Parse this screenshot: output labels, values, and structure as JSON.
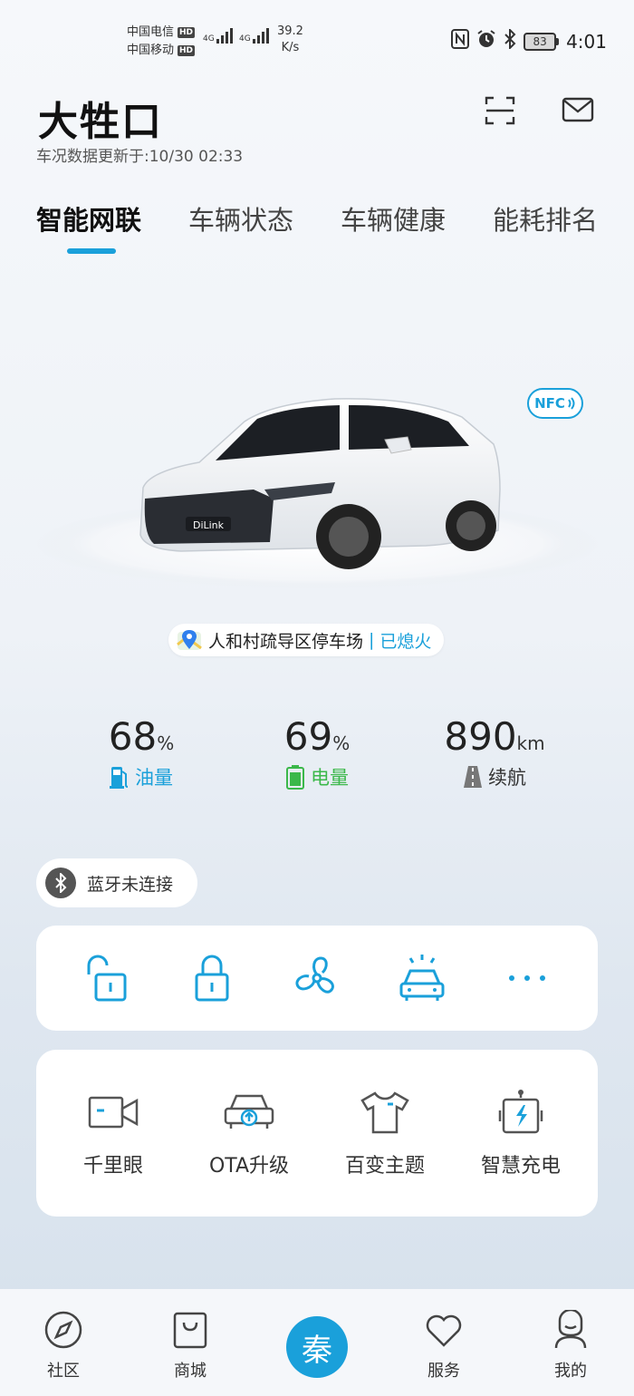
{
  "status_bar": {
    "carrier1": "中国电信",
    "carrier2": "中国移动",
    "hd": "HD",
    "net1": "4G",
    "net2": "4G",
    "speed_value": "39.2",
    "speed_unit": "K/s",
    "battery": "83",
    "time": "4:01"
  },
  "header": {
    "title": "大牲口",
    "updated": "车况数据更新于:10/30 02:33"
  },
  "tabs": [
    {
      "label": "智能网联",
      "active": true
    },
    {
      "label": "车辆状态",
      "active": false
    },
    {
      "label": "车辆健康",
      "active": false
    },
    {
      "label": "能耗排名",
      "active": false
    }
  ],
  "car": {
    "nfc_label": "NFC",
    "plate_text": "DiLink",
    "location": "人和村疏导区停车场",
    "separator": "|",
    "engine_status": "已熄火"
  },
  "stats": [
    {
      "value": "68",
      "unit": "%",
      "label": "油量",
      "color": "#1aa0da"
    },
    {
      "value": "69",
      "unit": "%",
      "label": "电量",
      "color": "#3bb84a"
    },
    {
      "value": "890",
      "unit": "km",
      "label": "续航",
      "color": "#333333"
    }
  ],
  "bluetooth": {
    "label": "蓝牙未连接"
  },
  "controls": [
    {
      "icon": "unlock-icon"
    },
    {
      "icon": "lock-icon"
    },
    {
      "icon": "fan-icon"
    },
    {
      "icon": "car-find-icon"
    },
    {
      "icon": "more-icon"
    }
  ],
  "features": [
    {
      "label": "千里眼",
      "icon": "camera-icon"
    },
    {
      "label": "OTA升级",
      "icon": "ota-icon"
    },
    {
      "label": "百变主题",
      "icon": "theme-icon"
    },
    {
      "label": "智慧充电",
      "icon": "charge-icon"
    }
  ],
  "bottom_nav": [
    {
      "label": "社区",
      "icon": "compass-icon"
    },
    {
      "label": "商城",
      "icon": "shopping-bag-icon"
    },
    {
      "label": "秦",
      "icon": "brand-logo"
    },
    {
      "label": "服务",
      "icon": "heart-icon"
    },
    {
      "label": "我的",
      "icon": "profile-icon"
    }
  ],
  "colors": {
    "accent": "#1aa0da",
    "green": "#3bb84a"
  }
}
